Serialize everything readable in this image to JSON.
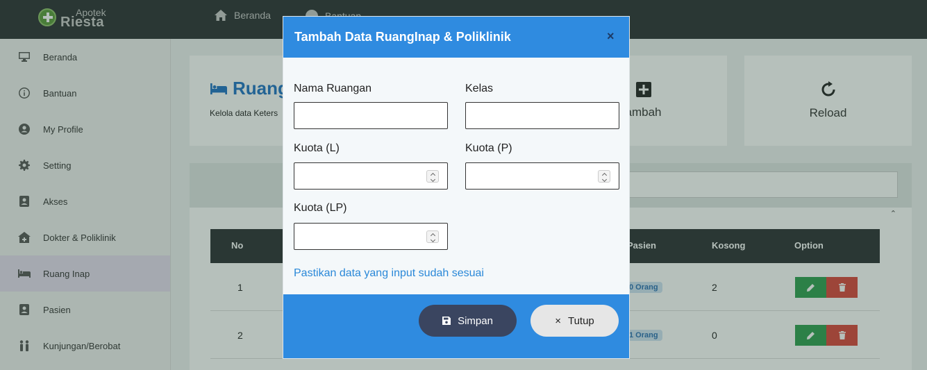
{
  "app": {
    "logo_top": "Apotek",
    "logo_bottom": "Riesta"
  },
  "topnav": {
    "home_label": "Beranda",
    "help_label": "Bantuan"
  },
  "sidebar": {
    "items": [
      {
        "label": "Beranda",
        "icon": "monitor-icon"
      },
      {
        "label": "Bantuan",
        "icon": "info-icon"
      },
      {
        "label": "My Profile",
        "icon": "user-circle-icon"
      },
      {
        "label": "Setting",
        "icon": "gear-icon"
      },
      {
        "label": "Akses",
        "icon": "id-card-icon"
      },
      {
        "label": "Dokter & Poliklinik",
        "icon": "clinic-icon"
      },
      {
        "label": "Ruang Inap",
        "icon": "bed-icon"
      },
      {
        "label": "Pasien",
        "icon": "patient-icon"
      },
      {
        "label": "Kunjungan/Berobat",
        "icon": "people-icon"
      }
    ],
    "active": "Ruang Inap"
  },
  "page": {
    "title": "Ruang",
    "subtitle": "Kelola data Keters",
    "actions": {
      "add_label": "ambah",
      "reload_label": "Reload"
    }
  },
  "table": {
    "headers": {
      "no": "No",
      "pasien": "Pasien",
      "kosong": "Kosong",
      "option": "Option"
    },
    "rows": [
      {
        "no": "1",
        "pasien": "0 Orang",
        "kosong": "2"
      },
      {
        "no": "2",
        "pasien": "1 Orang",
        "kosong": "0"
      }
    ]
  },
  "modal": {
    "title": "Tambah Data RuangInap & Poliklinik",
    "close_glyph": "×",
    "fields": {
      "nama_ruangan": {
        "label": "Nama Ruangan",
        "value": ""
      },
      "kelas": {
        "label": "Kelas",
        "value": ""
      },
      "kuota_l": {
        "label": "Kuota (L)",
        "value": ""
      },
      "kuota_p": {
        "label": "Kuota (P)",
        "value": ""
      },
      "kuota_lp": {
        "label": "Kuota (LP)",
        "value": ""
      }
    },
    "note": "Pastikan data yang input sudah sesuai",
    "buttons": {
      "save": "Simpan",
      "close": "Tutup",
      "close_glyph": "×"
    }
  },
  "colors": {
    "modal_header": "#2f8be0",
    "title_blue": "#1f72c4",
    "save_button": "#3a4560",
    "edit_green": "#2e9e4f",
    "delete_red": "#d9453b"
  }
}
